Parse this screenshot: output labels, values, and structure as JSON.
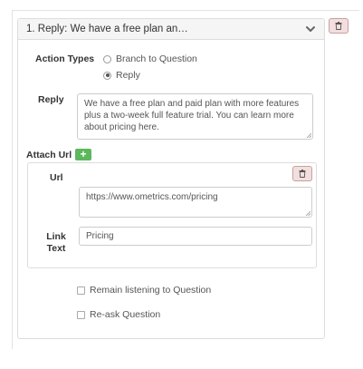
{
  "panel": {
    "title": "1. Reply: We have a free plan an…"
  },
  "action_types": {
    "label": "Action Types",
    "options": [
      {
        "label": "Branch to Question",
        "checked": false
      },
      {
        "label": "Reply",
        "checked": true
      }
    ]
  },
  "reply": {
    "label": "Reply",
    "value": "We have a free plan and paid plan with more features plus a two-week full feature trial. You can learn more about pricing here."
  },
  "attach_url": {
    "label": "Attach Url",
    "add_label": "+"
  },
  "url_item": {
    "url_label": "Url",
    "url_value": "https://www.ometrics.com/pricing",
    "link_text_label": "Link Text",
    "link_text_value": "Pricing"
  },
  "options": {
    "remain_listening": "Remain listening to Question",
    "reask": "Re-ask Question"
  },
  "icons": {
    "chevron": "chevron-down-icon",
    "delete": "trash-icon",
    "add": "plus-icon"
  },
  "colors": {
    "delete_bg": "#f2dede",
    "add_bg": "#5cb85c"
  }
}
